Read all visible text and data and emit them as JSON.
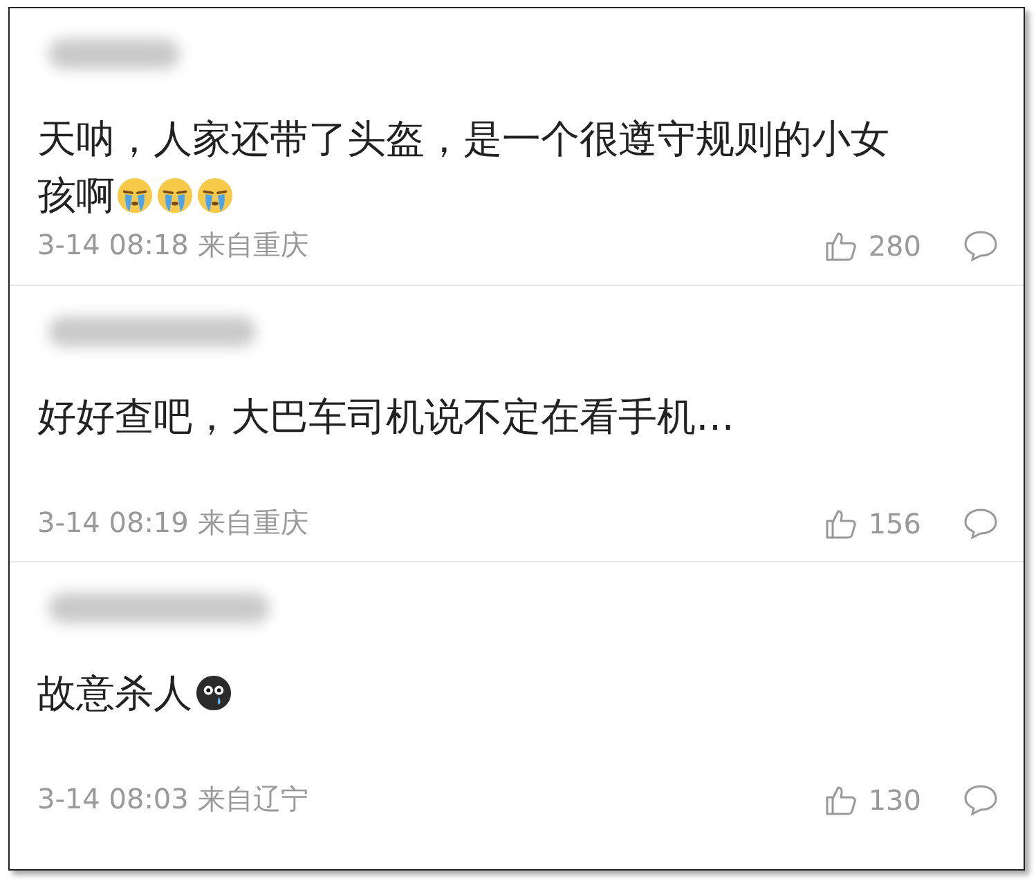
{
  "comments": [
    {
      "text": "天呐，人家还带了头盔，是一个很遵守规则的小女孩啊",
      "emojis": [
        {
          "kind": "crying"
        },
        {
          "kind": "crying"
        },
        {
          "kind": "crying"
        }
      ],
      "time": "3-14 08:18",
      "location": "来自重庆",
      "likes": "280"
    },
    {
      "text": "好好查吧，大巴车司机说不定在看手机…",
      "time": "3-14 08:19",
      "location": "来自重庆",
      "likes": "156"
    },
    {
      "text": "故意杀人",
      "emojis": [
        {
          "kind": "tearful"
        }
      ],
      "time": "3-14 08:03",
      "location": "来自辽宁",
      "likes": "130"
    }
  ]
}
